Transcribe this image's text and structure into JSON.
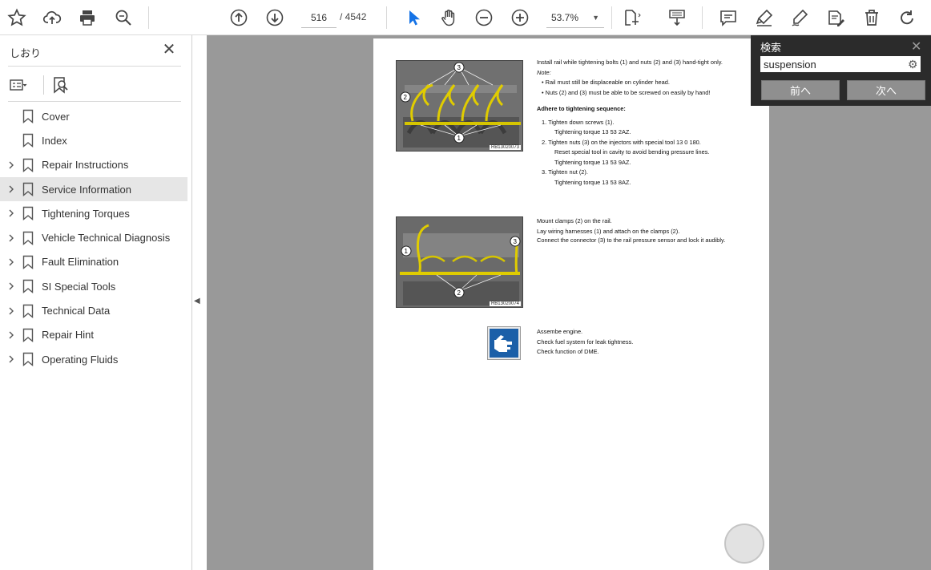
{
  "toolbar": {
    "page_current": "516",
    "page_total": "/ 4542",
    "zoom_level": "53.7%",
    "icons": [
      "star-icon",
      "cloud-upload-icon",
      "print-icon",
      "zoom-search-icon",
      "arrow-up-icon",
      "arrow-down-icon",
      "cursor-icon",
      "hand-icon",
      "zoom-out-icon",
      "zoom-in-icon",
      "page-fit-icon",
      "scroll-mode-icon",
      "comment-icon",
      "highlight-icon",
      "sign-icon",
      "edit-pdf-icon",
      "trash-icon",
      "rotate-icon"
    ]
  },
  "sidebar": {
    "title": "しおり",
    "items": [
      {
        "label": "Cover",
        "expandable": false
      },
      {
        "label": "Index",
        "expandable": false
      },
      {
        "label": "Repair Instructions",
        "expandable": true
      },
      {
        "label": "Service Information",
        "expandable": true,
        "selected": true
      },
      {
        "label": "Tightening Torques",
        "expandable": true
      },
      {
        "label": "Vehicle Technical Diagnosis",
        "expandable": true
      },
      {
        "label": "Fault Elimination",
        "expandable": true
      },
      {
        "label": "SI Special Tools",
        "expandable": true
      },
      {
        "label": "Technical Data",
        "expandable": true
      },
      {
        "label": "Repair Hint",
        "expandable": true
      },
      {
        "label": "Operating Fluids",
        "expandable": true
      }
    ]
  },
  "document": {
    "fig1_code": "RB13020073",
    "fig2_code": "RB13020074",
    "block1": {
      "line1": "Install rail while tightening bolts (1) and nuts (2) and (3) hand-tight only.",
      "note": "Note:",
      "bullet1": "Rail must still be displaceable on cylinder head.",
      "bullet2": "Nuts (2) and (3) must be able to be screwed on easily by hand!",
      "heading": "Adhere to tightening sequence:",
      "s1a": "1.   Tighten down screws (1).",
      "s1b": "Tightening torque 13 53 2AZ.",
      "s2a": "2.   Tighten nuts (3) on the injectors with special tool 13 0 180.",
      "s2b": "Reset special tool in cavity to avoid bending pressure lines.",
      "s2c": "Tightening torque 13 53 9AZ.",
      "s3a": "3.   Tighten nut (2).",
      "s3b": "Tightening torque 13 53 8AZ."
    },
    "block2": {
      "line1": "Mount clamps (2) on the rail.",
      "line2": "Lay wiring harnesses (1) and attach on the clamps (2).",
      "line3": "Connect the connector (3) to the rail pressure sensor and lock it audibly."
    },
    "block3": {
      "line1": "Assembe engine.",
      "line2": "Check fuel system for leak tightness.",
      "line3": "Check function of DME."
    }
  },
  "search": {
    "title": "検索",
    "value": "suspension",
    "prev_label": "前へ",
    "next_label": "次へ"
  }
}
